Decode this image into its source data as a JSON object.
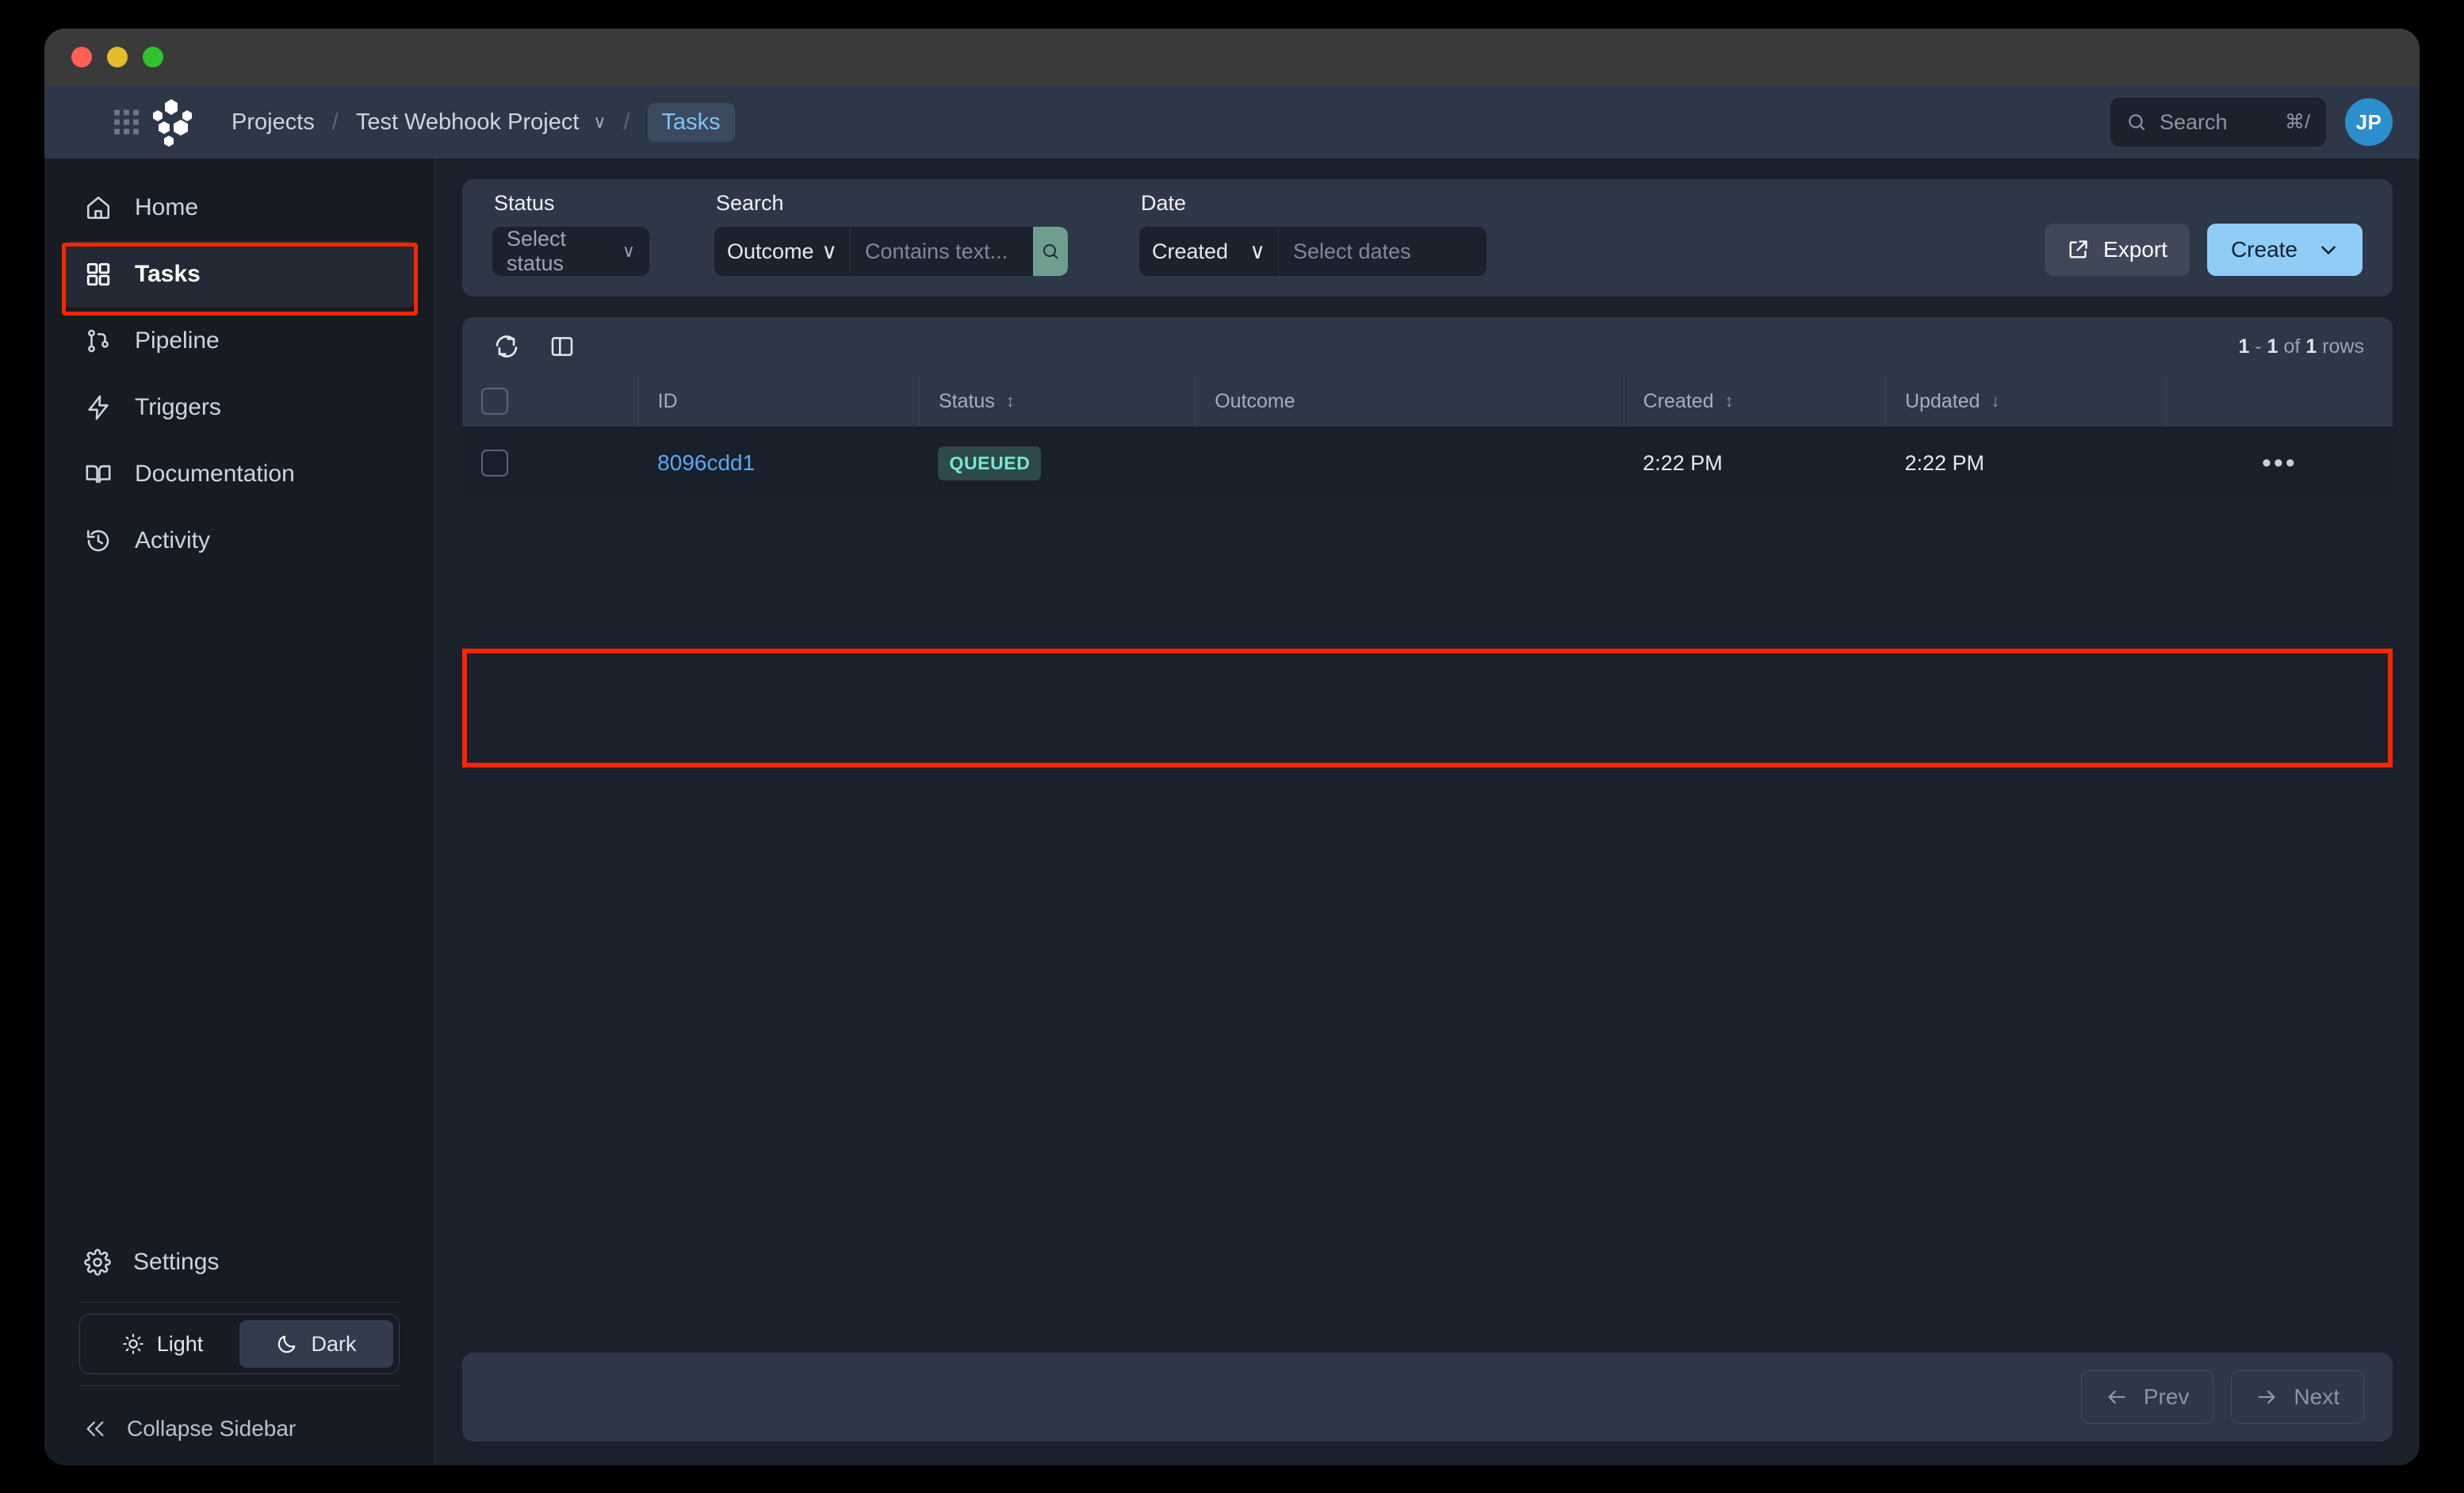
{
  "window": {
    "traffic_lights": [
      "close",
      "minimize",
      "maximize"
    ]
  },
  "header": {
    "breadcrumb": {
      "root": "Projects",
      "project": "Test Webhook Project",
      "current": "Tasks",
      "separator": "/",
      "chevron": "∨"
    },
    "search": {
      "placeholder": "Search",
      "shortcut": "⌘/"
    },
    "avatar_initials": "JP"
  },
  "sidebar": {
    "items": [
      {
        "label": "Home",
        "icon": "home-icon",
        "active": false
      },
      {
        "label": "Tasks",
        "icon": "grid-icon",
        "active": true
      },
      {
        "label": "Pipeline",
        "icon": "pipeline-icon",
        "active": false
      },
      {
        "label": "Triggers",
        "icon": "bolt-icon",
        "active": false
      },
      {
        "label": "Documentation",
        "icon": "book-icon",
        "active": false
      },
      {
        "label": "Activity",
        "icon": "history-icon",
        "active": false
      }
    ],
    "settings_label": "Settings",
    "theme": {
      "light_label": "Light",
      "dark_label": "Dark",
      "selected": "Dark"
    },
    "collapse_label": "Collapse Sidebar"
  },
  "filters": {
    "status": {
      "label": "Status",
      "value": "",
      "placeholder": "Select status"
    },
    "search": {
      "label": "Search",
      "type_value": "Outcome",
      "text_value": "",
      "text_placeholder": "Contains text..."
    },
    "date": {
      "label": "Date",
      "type_value": "Created",
      "value": "",
      "placeholder": "Select dates"
    },
    "export_label": "Export",
    "create_label": "Create"
  },
  "table": {
    "row_count_text": "1 - 1 of 1 rows",
    "row_count_parts": {
      "from": "1",
      "dash": "-",
      "to": "1",
      "of": "of",
      "total": "1",
      "unit": "rows"
    },
    "columns": [
      {
        "key": "select",
        "label": "",
        "sortable": false
      },
      {
        "key": "id",
        "label": "ID",
        "sortable": false
      },
      {
        "key": "status",
        "label": "Status",
        "sortable": true,
        "sort_state": "none"
      },
      {
        "key": "outcome",
        "label": "Outcome",
        "sortable": false
      },
      {
        "key": "created",
        "label": "Created",
        "sortable": true,
        "sort_state": "none"
      },
      {
        "key": "updated",
        "label": "Updated",
        "sortable": true,
        "sort_state": "desc"
      },
      {
        "key": "actions",
        "label": "",
        "sortable": false
      }
    ],
    "rows": [
      {
        "id": "8096cdd1",
        "status": "QUEUED",
        "outcome": "",
        "created": "2:22 PM",
        "updated": "2:22 PM",
        "actions": "•••"
      }
    ]
  },
  "pagination": {
    "prev_label": "Prev",
    "next_label": "Next"
  },
  "colors": {
    "accent_blue": "#8fcdf7",
    "link_blue": "#5aa9f0",
    "badge_bg": "#2d4a4a",
    "badge_text": "#79e6d6",
    "sidebar_bg": "#171b24",
    "main_bg": "#1a202c",
    "panel_bg": "#2d3748",
    "highlight_red": "#ff2400",
    "avatar_bg": "#2b8fcd",
    "search_go_bg": "#6f9e91"
  }
}
